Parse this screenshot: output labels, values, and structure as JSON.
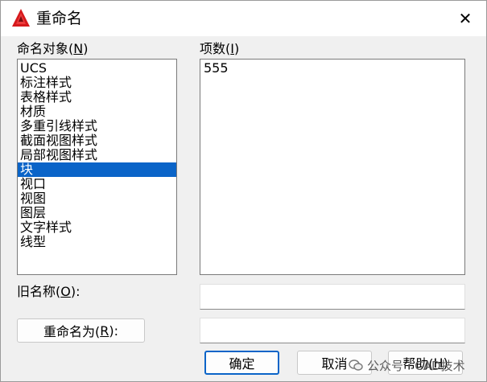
{
  "window": {
    "title": "重命名",
    "close_glyph": "✕"
  },
  "left": {
    "label_prefix": "命名对象(",
    "label_key": "N",
    "label_suffix": ")",
    "items": [
      {
        "label": "UCS",
        "selected": false
      },
      {
        "label": "标注样式",
        "selected": false
      },
      {
        "label": "表格样式",
        "selected": false
      },
      {
        "label": "材质",
        "selected": false
      },
      {
        "label": "多重引线样式",
        "selected": false
      },
      {
        "label": "截面视图样式",
        "selected": false
      },
      {
        "label": "局部视图样式",
        "selected": false
      },
      {
        "label": "块",
        "selected": true
      },
      {
        "label": "视口",
        "selected": false
      },
      {
        "label": "视图",
        "selected": false
      },
      {
        "label": "图层",
        "selected": false
      },
      {
        "label": "文字样式",
        "selected": false
      },
      {
        "label": "线型",
        "selected": false
      }
    ]
  },
  "right": {
    "label_prefix": "项数(",
    "label_key": "I",
    "label_suffix": ")",
    "items": [
      "555"
    ]
  },
  "old_name": {
    "label_prefix": "旧名称(",
    "label_key": "O",
    "label_suffix": "):",
    "value": ""
  },
  "rename_to": {
    "button_prefix": "重命名为(",
    "button_key": "R",
    "button_suffix": "):",
    "value": ""
  },
  "buttons": {
    "ok": "确定",
    "cancel": "取消",
    "help_prefix": "帮助(",
    "help_key": "H",
    "help_suffix": ")"
  },
  "watermark": {
    "text": "公众号 · CAD技术"
  },
  "colors": {
    "selection": "#0a64c8",
    "default_button_border": "#0a64c8",
    "app_icon": "#d6191c"
  },
  "icons": {
    "app": "autocad-a-icon",
    "close": "close-icon"
  }
}
